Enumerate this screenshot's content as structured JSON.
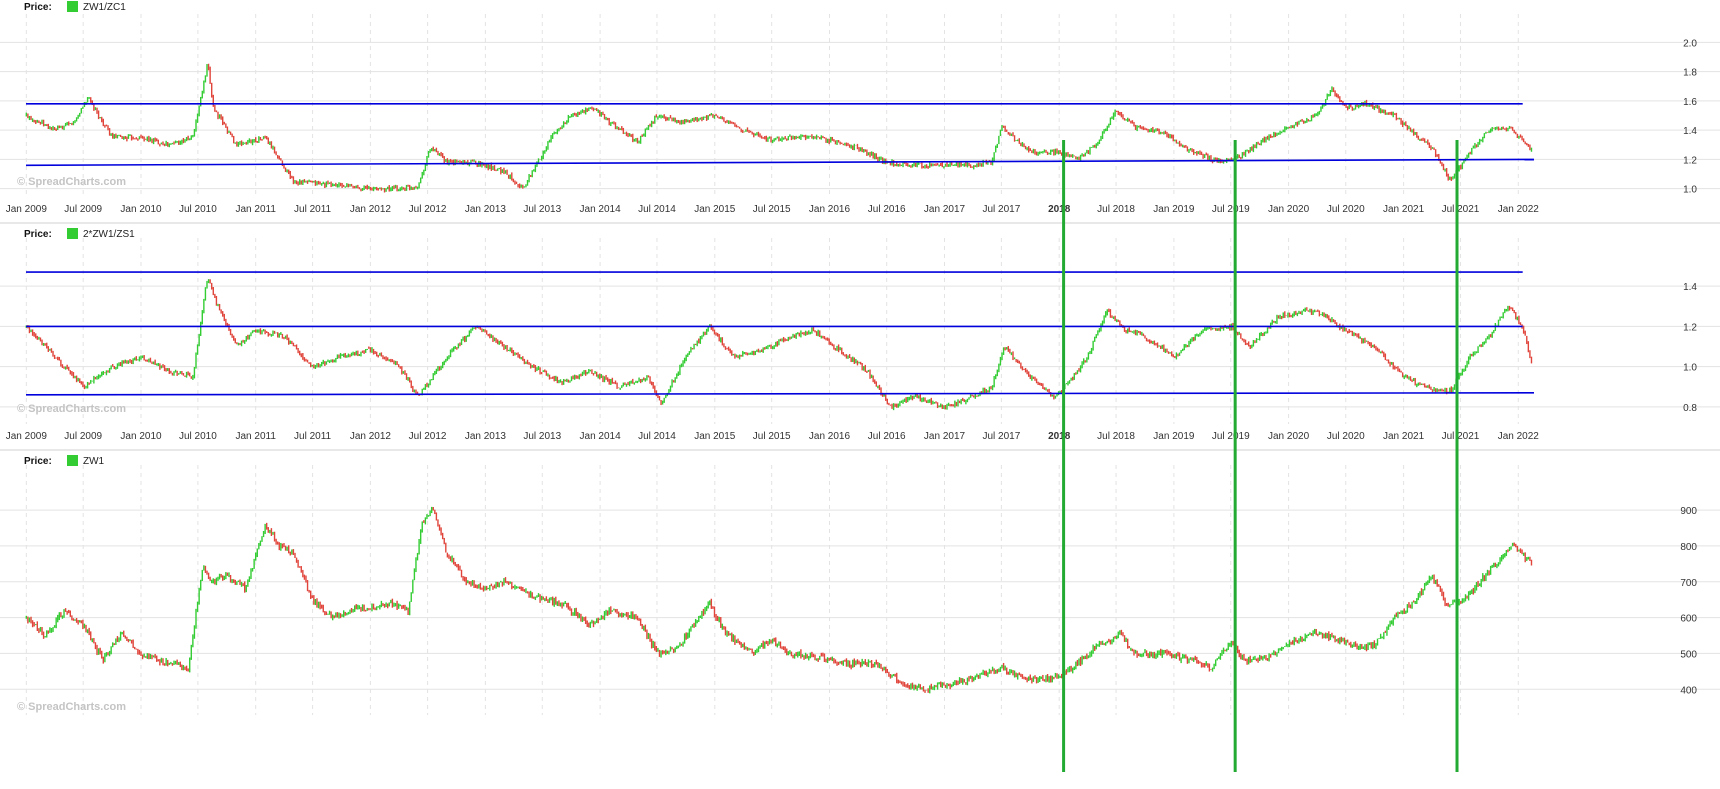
{
  "watermark": "© SpreadCharts.com",
  "price_label": "Price:",
  "colors": {
    "up": "#33cc33",
    "down": "#e0443a",
    "level_line": "#0000dd",
    "marker_line": "#22aa33",
    "grid": "#e3e3e3",
    "axis_text": "#333333",
    "separator": "#e8e8e8"
  },
  "markers": [
    "2018-01-15",
    "2019-07-15",
    "2021-06-20"
  ],
  "chart_data": [
    {
      "type": "line",
      "style": "candlestick",
      "legend": "ZW1/ZC1",
      "ylim": [
        0.95,
        2.05
      ],
      "yticks": [
        "2.0",
        "1.8",
        "1.6",
        "1.4",
        "1.2",
        "1.0"
      ],
      "x_range": [
        "2008-12-31",
        "2022-02-20"
      ],
      "xticks": [
        {
          "date": "2009-01-01",
          "label": "Jan 2009"
        },
        {
          "date": "2009-07-01",
          "label": "Jul 2009"
        },
        {
          "date": "2010-01-01",
          "label": "Jan 2010"
        },
        {
          "date": "2010-07-01",
          "label": "Jul 2010"
        },
        {
          "date": "2011-01-01",
          "label": "Jan 2011"
        },
        {
          "date": "2011-07-01",
          "label": "Jul 2011"
        },
        {
          "date": "2012-01-01",
          "label": "Jan 2012"
        },
        {
          "date": "2012-07-01",
          "label": "Jul 2012"
        },
        {
          "date": "2013-01-01",
          "label": "Jan 2013"
        },
        {
          "date": "2013-07-01",
          "label": "Jul 2013"
        },
        {
          "date": "2014-01-01",
          "label": "Jan 2014"
        },
        {
          "date": "2014-07-01",
          "label": "Jul 2014"
        },
        {
          "date": "2015-01-01",
          "label": "Jan 2015"
        },
        {
          "date": "2015-07-01",
          "label": "Jul 2015"
        },
        {
          "date": "2016-01-01",
          "label": "Jan 2016"
        },
        {
          "date": "2016-07-01",
          "label": "Jul 2016"
        },
        {
          "date": "2017-01-01",
          "label": "Jan 2017"
        },
        {
          "date": "2017-07-01",
          "label": "Jul 2017"
        },
        {
          "date": "2018-01-01",
          "label": "2018",
          "bold": true
        },
        {
          "date": "2018-07-01",
          "label": "Jul 2018"
        },
        {
          "date": "2019-01-01",
          "label": "Jan 2019"
        },
        {
          "date": "2019-07-01",
          "label": "Jul 2019"
        },
        {
          "date": "2020-01-01",
          "label": "Jan 2020"
        },
        {
          "date": "2020-07-01",
          "label": "Jul 2020"
        },
        {
          "date": "2021-01-01",
          "label": "Jan 2021"
        },
        {
          "date": "2021-07-01",
          "label": "Jul 2021"
        },
        {
          "date": "2022-01-01",
          "label": "Jan 2022"
        }
      ],
      "levels": [
        {
          "y1": 1.58,
          "y2": 1.58,
          "x_end": "2022-01-15"
        },
        {
          "y1": 1.16,
          "y2": 1.2,
          "x_end": "2022-02-20"
        }
      ],
      "x": [
        "2009-01-01",
        "2009-04-01",
        "2009-06-01",
        "2009-07-15",
        "2009-10-01",
        "2010-01-01",
        "2010-04-01",
        "2010-06-15",
        "2010-08-01",
        "2010-08-20",
        "2010-11-01",
        "2011-02-01",
        "2011-05-01",
        "2011-07-01",
        "2011-10-01",
        "2012-01-01",
        "2012-04-01",
        "2012-06-01",
        "2012-07-10",
        "2012-09-01",
        "2012-12-01",
        "2013-03-01",
        "2013-05-01",
        "2013-08-01",
        "2013-10-01",
        "2013-12-15",
        "2014-02-01",
        "2014-05-01",
        "2014-07-01",
        "2014-10-01",
        "2015-01-01",
        "2015-04-01",
        "2015-07-01",
        "2015-10-01",
        "2016-01-01",
        "2016-04-01",
        "2016-07-01",
        "2016-10-01",
        "2017-01-01",
        "2017-04-01",
        "2017-06-01",
        "2017-07-01",
        "2017-10-01",
        "2018-01-01",
        "2018-03-01",
        "2018-05-01",
        "2018-07-01",
        "2018-09-01",
        "2018-12-01",
        "2019-03-01",
        "2019-06-01",
        "2019-08-01",
        "2019-10-01",
        "2020-01-01",
        "2020-04-01",
        "2020-05-15",
        "2020-07-01",
        "2020-09-01",
        "2020-12-01",
        "2021-02-01",
        "2021-04-01",
        "2021-06-01",
        "2021-08-01",
        "2021-10-01",
        "2021-12-01",
        "2022-02-15"
      ],
      "values": [
        1.5,
        1.4,
        1.45,
        1.62,
        1.35,
        1.35,
        1.3,
        1.35,
        1.85,
        1.55,
        1.3,
        1.35,
        1.05,
        1.04,
        1.02,
        1.0,
        1.0,
        1.02,
        1.28,
        1.18,
        1.18,
        1.12,
        1.0,
        1.36,
        1.5,
        1.55,
        1.45,
        1.32,
        1.5,
        1.45,
        1.5,
        1.4,
        1.33,
        1.36,
        1.33,
        1.28,
        1.18,
        1.16,
        1.16,
        1.16,
        1.18,
        1.42,
        1.25,
        1.25,
        1.2,
        1.3,
        1.53,
        1.42,
        1.38,
        1.25,
        1.18,
        1.22,
        1.32,
        1.42,
        1.5,
        1.68,
        1.55,
        1.58,
        1.5,
        1.38,
        1.28,
        1.05,
        1.25,
        1.4,
        1.42,
        1.26
      ]
    },
    {
      "type": "line",
      "style": "candlestick",
      "legend": "2*ZW1/ZS1",
      "ylim": [
        0.72,
        1.52
      ],
      "yticks": [
        "1.4",
        "1.2",
        "1.0",
        "0.8"
      ],
      "x_range": [
        "2008-12-31",
        "2022-02-20"
      ],
      "xticks": [
        {
          "date": "2009-01-01",
          "label": "Jan 2009"
        },
        {
          "date": "2009-07-01",
          "label": "Jul 2009"
        },
        {
          "date": "2010-01-01",
          "label": "Jan 2010"
        },
        {
          "date": "2010-07-01",
          "label": "Jul 2010"
        },
        {
          "date": "2011-01-01",
          "label": "Jan 2011"
        },
        {
          "date": "2011-07-01",
          "label": "Jul 2011"
        },
        {
          "date": "2012-01-01",
          "label": "Jan 2012"
        },
        {
          "date": "2012-07-01",
          "label": "Jul 2012"
        },
        {
          "date": "2013-01-01",
          "label": "Jan 2013"
        },
        {
          "date": "2013-07-01",
          "label": "Jul 2013"
        },
        {
          "date": "2014-01-01",
          "label": "Jan 2014"
        },
        {
          "date": "2014-07-01",
          "label": "Jul 2014"
        },
        {
          "date": "2015-01-01",
          "label": "Jan 2015"
        },
        {
          "date": "2015-07-01",
          "label": "Jul 2015"
        },
        {
          "date": "2016-01-01",
          "label": "Jan 2016"
        },
        {
          "date": "2016-07-01",
          "label": "Jul 2016"
        },
        {
          "date": "2017-01-01",
          "label": "Jan 2017"
        },
        {
          "date": "2017-07-01",
          "label": "Jul 2017"
        },
        {
          "date": "2018-01-01",
          "label": "2018",
          "bold": true
        },
        {
          "date": "2018-07-01",
          "label": "Jul 2018"
        },
        {
          "date": "2019-01-01",
          "label": "Jan 2019"
        },
        {
          "date": "2019-07-01",
          "label": "Jul 2019"
        },
        {
          "date": "2020-01-01",
          "label": "Jan 2020"
        },
        {
          "date": "2020-07-01",
          "label": "Jul 2020"
        },
        {
          "date": "2021-01-01",
          "label": "Jan 2021"
        },
        {
          "date": "2021-07-01",
          "label": "Jul 2021"
        },
        {
          "date": "2022-01-01",
          "label": "Jan 2022"
        }
      ],
      "levels": [
        {
          "y1": 1.47,
          "y2": 1.47,
          "x_end": "2022-01-15"
        },
        {
          "y1": 1.2,
          "y2": 1.2,
          "x_end": "2022-01-15"
        },
        {
          "y1": 0.86,
          "y2": 0.87,
          "x_end": "2022-02-20"
        }
      ],
      "x": [
        "2009-01-01",
        "2009-04-01",
        "2009-07-01",
        "2009-10-01",
        "2010-01-01",
        "2010-04-01",
        "2010-06-15",
        "2010-08-01",
        "2010-08-20",
        "2010-11-01",
        "2011-01-01",
        "2011-04-01",
        "2011-07-01",
        "2011-10-01",
        "2012-01-01",
        "2012-04-01",
        "2012-06-01",
        "2012-09-01",
        "2012-12-01",
        "2013-03-01",
        "2013-06-01",
        "2013-09-01",
        "2013-12-01",
        "2014-03-01",
        "2014-06-01",
        "2014-07-15",
        "2014-10-01",
        "2014-12-15",
        "2015-03-01",
        "2015-06-01",
        "2015-09-01",
        "2015-11-15",
        "2016-02-01",
        "2016-05-01",
        "2016-07-15",
        "2016-10-01",
        "2017-01-01",
        "2017-04-01",
        "2017-06-01",
        "2017-07-10",
        "2017-10-01",
        "2017-12-15",
        "2018-02-01",
        "2018-04-01",
        "2018-06-01",
        "2018-08-01",
        "2018-10-01",
        "2019-01-01",
        "2019-04-01",
        "2019-07-01",
        "2019-09-01",
        "2019-12-01",
        "2020-03-01",
        "2020-05-01",
        "2020-07-01",
        "2020-10-01",
        "2021-01-01",
        "2021-04-01",
        "2021-06-01",
        "2021-08-01",
        "2021-10-01",
        "2021-12-01",
        "2022-01-15",
        "2022-02-15"
      ],
      "values": [
        1.2,
        1.05,
        0.9,
        1.0,
        1.05,
        0.98,
        0.95,
        1.45,
        1.35,
        1.1,
        1.18,
        1.15,
        1.0,
        1.05,
        1.08,
        1.0,
        0.85,
        1.05,
        1.2,
        1.1,
        1.0,
        0.92,
        0.98,
        0.9,
        0.95,
        0.82,
        1.05,
        1.2,
        1.05,
        1.08,
        1.15,
        1.18,
        1.08,
        0.98,
        0.8,
        0.85,
        0.8,
        0.85,
        0.9,
        1.1,
        0.95,
        0.85,
        0.92,
        1.05,
        1.28,
        1.18,
        1.15,
        1.05,
        1.18,
        1.2,
        1.1,
        1.25,
        1.28,
        1.25,
        1.18,
        1.1,
        0.95,
        0.88,
        0.88,
        1.05,
        1.15,
        1.3,
        1.2,
        1.0
      ]
    },
    {
      "type": "line",
      "style": "candlestick",
      "legend": "ZW1",
      "ylim": [
        370,
        970
      ],
      "yticks": [
        "900",
        "800",
        "700",
        "600",
        "500",
        "400"
      ],
      "x_range": [
        "2008-12-31",
        "2022-02-20"
      ],
      "xticks": [],
      "levels": [],
      "x": [
        "2009-01-01",
        "2009-03-01",
        "2009-05-01",
        "2009-07-01",
        "2009-09-01",
        "2009-11-01",
        "2010-01-01",
        "2010-03-01",
        "2010-06-01",
        "2010-07-15",
        "2010-08-15",
        "2010-10-01",
        "2010-12-01",
        "2011-02-01",
        "2011-03-15",
        "2011-05-01",
        "2011-07-01",
        "2011-09-01",
        "2011-11-01",
        "2012-01-01",
        "2012-03-01",
        "2012-05-01",
        "2012-06-15",
        "2012-07-20",
        "2012-09-01",
        "2012-11-01",
        "2013-01-01",
        "2013-03-01",
        "2013-06-01",
        "2013-09-01",
        "2013-12-01",
        "2014-02-01",
        "2014-05-01",
        "2014-07-01",
        "2014-09-01",
        "2014-12-15",
        "2015-02-01",
        "2015-05-01",
        "2015-07-01",
        "2015-09-01",
        "2015-12-01",
        "2016-03-01",
        "2016-06-01",
        "2016-08-01",
        "2016-10-01",
        "2017-01-01",
        "2017-04-01",
        "2017-07-01",
        "2017-09-01",
        "2017-12-01",
        "2018-02-01",
        "2018-05-01",
        "2018-07-15",
        "2018-09-01",
        "2018-12-01",
        "2019-03-01",
        "2019-05-01",
        "2019-07-01",
        "2019-08-15",
        "2019-11-01",
        "2020-02-01",
        "2020-04-01",
        "2020-06-01",
        "2020-08-01",
        "2020-10-01",
        "2020-12-01",
        "2021-02-01",
        "2021-04-01",
        "2021-05-15",
        "2021-07-01",
        "2021-09-01",
        "2021-11-01",
        "2021-12-15",
        "2022-02-15"
      ],
      "values": [
        600,
        550,
        620,
        580,
        480,
        560,
        500,
        480,
        460,
        740,
        700,
        720,
        680,
        860,
        800,
        780,
        650,
        600,
        620,
        630,
        640,
        620,
        870,
        900,
        780,
        700,
        680,
        700,
        660,
        640,
        580,
        620,
        600,
        500,
        510,
        640,
        560,
        500,
        540,
        500,
        490,
        470,
        470,
        430,
        400,
        410,
        430,
        460,
        430,
        430,
        450,
        520,
        550,
        500,
        500,
        480,
        460,
        530,
        480,
        490,
        540,
        560,
        540,
        520,
        520,
        600,
        640,
        720,
        640,
        640,
        700,
        760,
        800,
        750
      ]
    }
  ]
}
